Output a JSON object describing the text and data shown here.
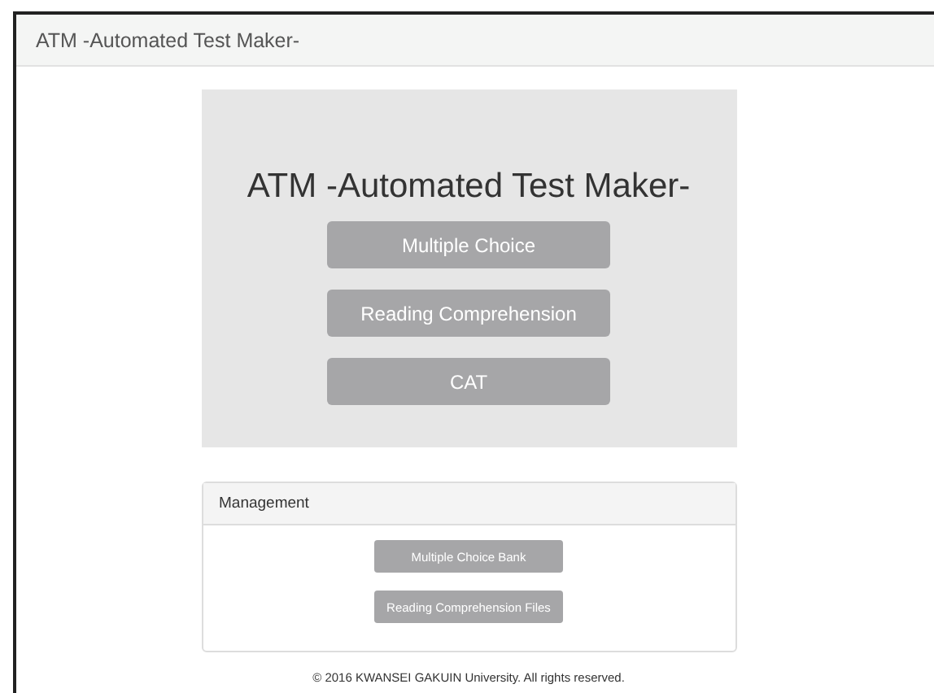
{
  "navbar": {
    "brand": "ATM -Automated Test Maker-"
  },
  "hero": {
    "title": "ATM -Automated Test Maker-",
    "buttons": [
      "Multiple Choice",
      "Reading Comprehension",
      "CAT"
    ]
  },
  "management": {
    "heading": "Management",
    "buttons": [
      "Multiple Choice Bank",
      "Reading Comprehension Files"
    ]
  },
  "footer": "© 2016 KWANSEI GAKUIN University. All rights reserved."
}
